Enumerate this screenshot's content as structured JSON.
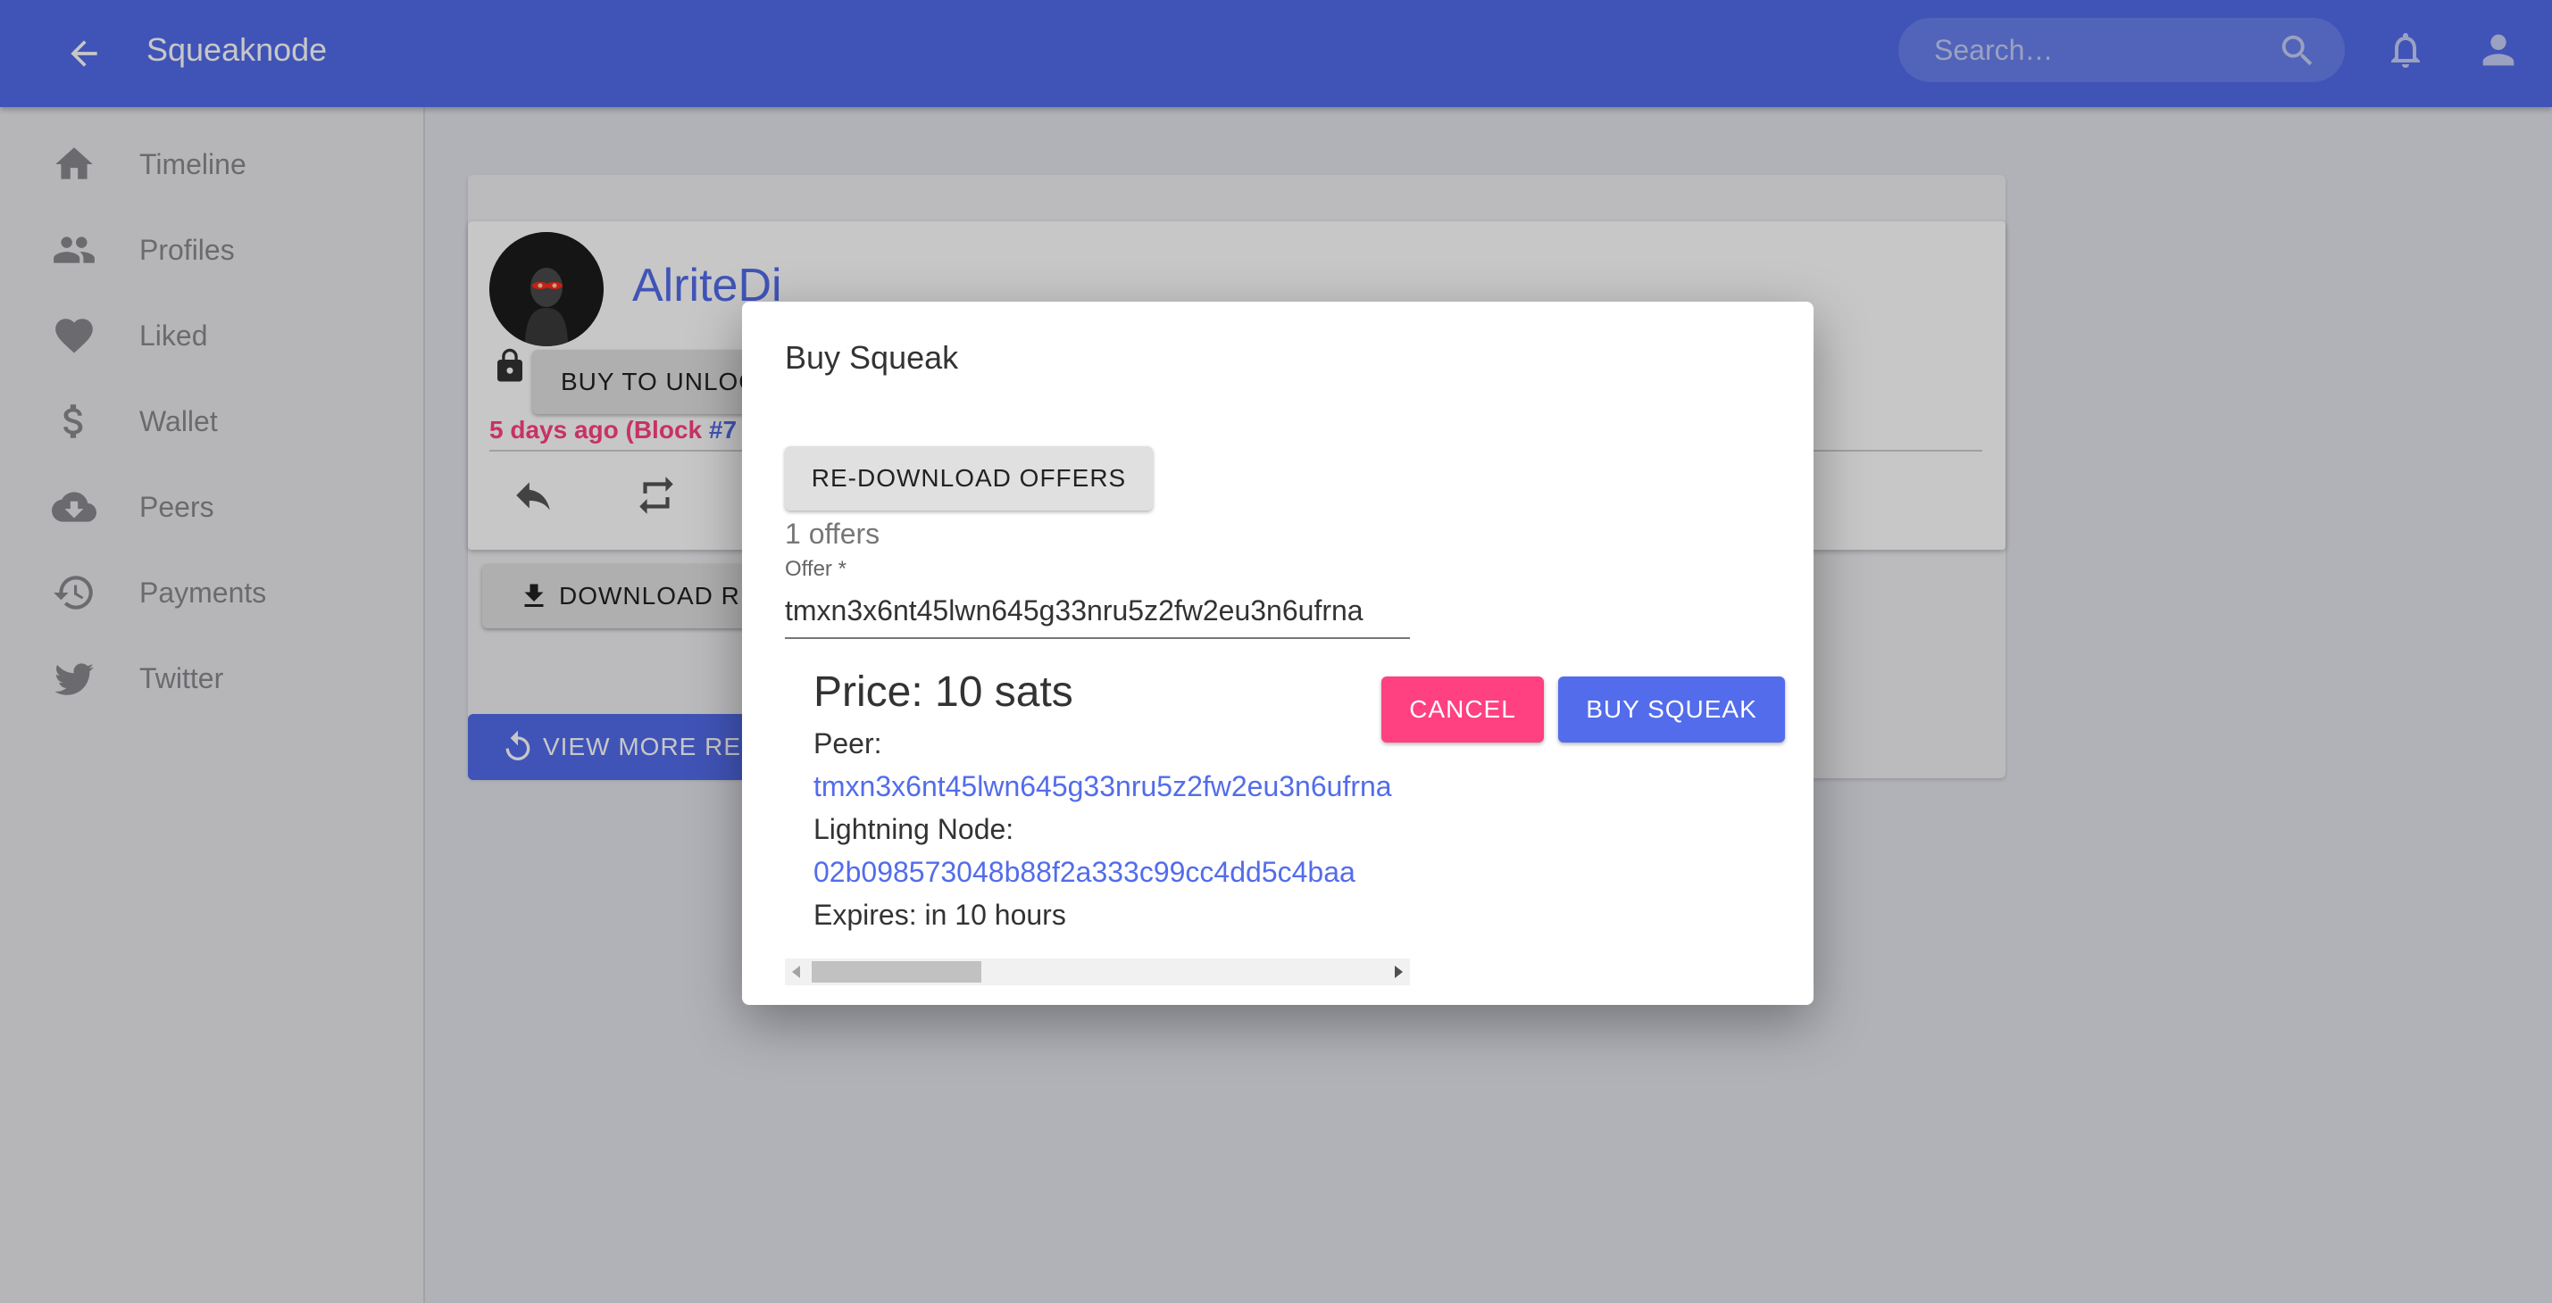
{
  "app": {
    "title": "Squeaknode"
  },
  "topbar": {
    "search_placeholder": "Search…",
    "icons": [
      "arrow-left-icon",
      "search-icon",
      "bell-icon",
      "account-icon"
    ]
  },
  "sidebar": {
    "items": [
      {
        "label": "Timeline",
        "icon": "home-icon"
      },
      {
        "label": "Profiles",
        "icon": "people-icon"
      },
      {
        "label": "Liked",
        "icon": "heart-icon"
      },
      {
        "label": "Wallet",
        "icon": "dollar-icon"
      },
      {
        "label": "Peers",
        "icon": "cloud-download-icon"
      },
      {
        "label": "Payments",
        "icon": "history-icon"
      },
      {
        "label": "Twitter",
        "icon": "twitter-icon"
      }
    ]
  },
  "squeak": {
    "author": "AlriteDi",
    "buy_to_unlock_label": "BUY TO UNLOCK",
    "time_text": "5 days ago (Block ",
    "block_link": "#7",
    "download_replies_label": "DOWNLOAD RE",
    "view_more_label": "VIEW MORE RE"
  },
  "dialog": {
    "title": "Buy Squeak",
    "redownload_label": "RE-DOWNLOAD OFFERS",
    "offers_count": "1 offers",
    "offer_label": "Offer *",
    "offer_value": "tmxn3x6nt45lwn645g33nru5z2fw2eu3n6ufrna",
    "price": "Price: 10 sats",
    "peer_label": "Peer:",
    "peer_value": "tmxn3x6nt45lwn645g33nru5z2fw2eu3n6ufrna",
    "lightning_label": "Lightning Node:",
    "lightning_value": "02b098573048b88f2a333c99cc4dd5c4baa",
    "expires": "Expires: in 10 hours",
    "cancel_label": "CANCEL",
    "buy_label": "BUY SQUEAK"
  },
  "colors": {
    "primary": "#536ceb",
    "accent": "#ff4081",
    "background": "#e3e4ec"
  }
}
